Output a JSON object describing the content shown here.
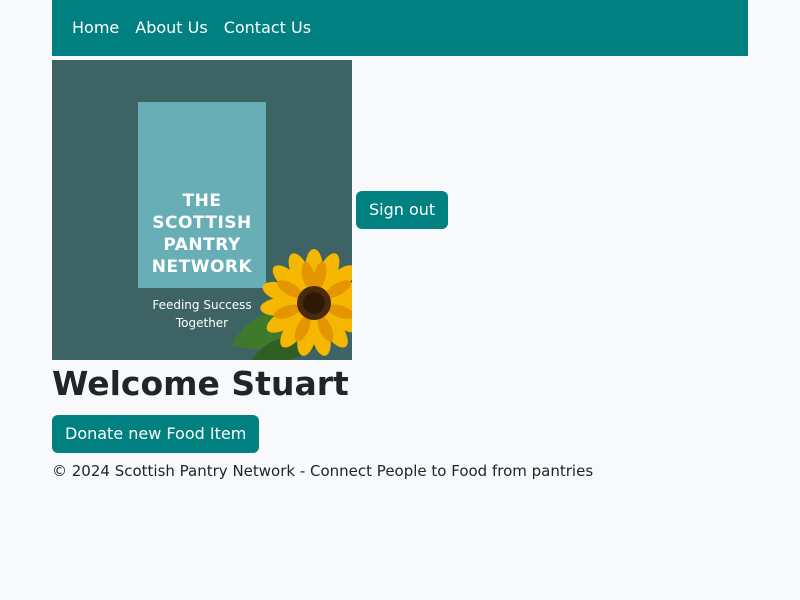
{
  "nav": {
    "items": [
      {
        "label": "Home"
      },
      {
        "label": "About Us"
      },
      {
        "label": "Contact Us"
      }
    ]
  },
  "logo": {
    "title_lines": [
      "THE",
      "SCOTTISH",
      "PANTRY",
      "NETWORK"
    ],
    "tagline_lines": [
      "Feeding Success",
      "Together"
    ]
  },
  "header": {
    "signout_label": "Sign out"
  },
  "main": {
    "welcome_heading": "Welcome Stuart",
    "donate_label": "Donate new Food Item"
  },
  "footer": {
    "text": "© 2024 Scottish Pantry Network - Connect People to Food from pantries"
  },
  "colors": {
    "brand": "#008080",
    "background": "#f8f9fa",
    "logo_bg": "#3d6364",
    "logo_card": "#67aeb6"
  },
  "icons": {
    "logo_flower": "sunflower-icon"
  }
}
